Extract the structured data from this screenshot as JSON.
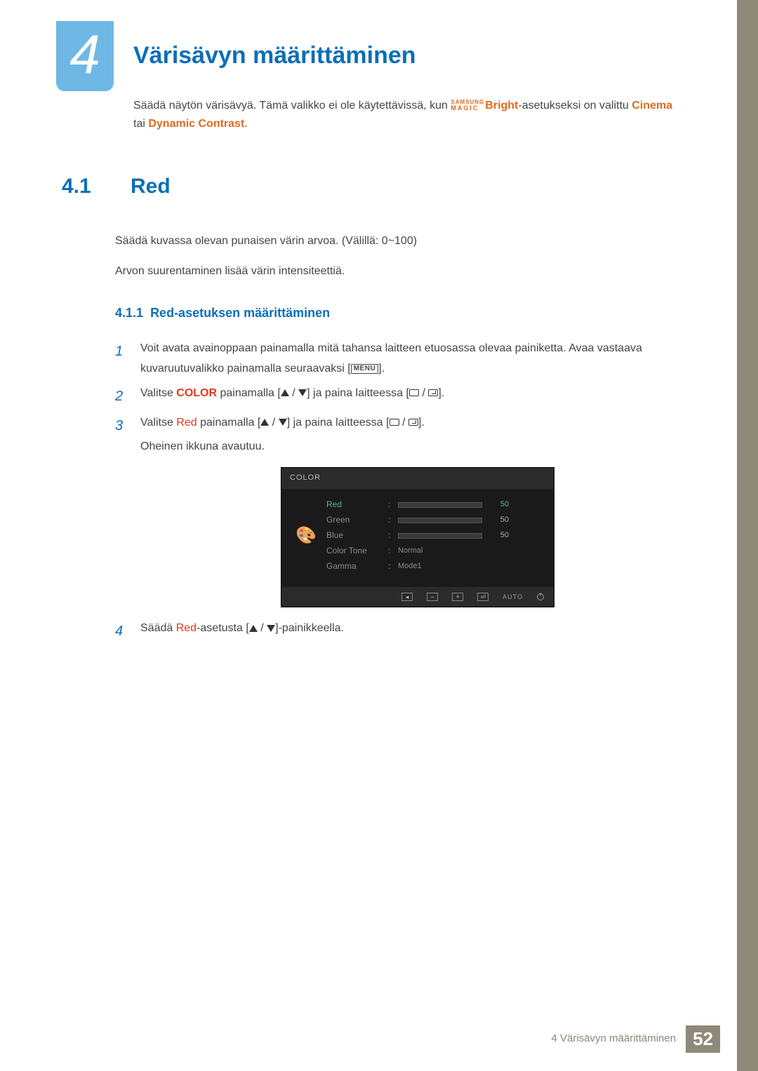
{
  "chapter": {
    "number": "4",
    "title": "Värisävyn määrittäminen"
  },
  "intro": {
    "part1": "Säädä näytön värisävyä. Tämä valikko ei ole käytettävissä, kun ",
    "magic_top": "SAMSUNG",
    "magic_bottom": "MAGIC",
    "bright": "Bright",
    "part2": "-asetukseksi on valittu ",
    "cinema": "Cinema",
    "or": " tai ",
    "dynamic": "Dynamic Contrast",
    "part3": "."
  },
  "section": {
    "num": "4.1",
    "title": "Red",
    "p1": "Säädä kuvassa olevan punaisen värin arvoa. (Välillä: 0~100)",
    "p2": "Arvon suurentaminen lisää värin intensiteettiä."
  },
  "subsection": {
    "num": "4.1.1",
    "title": "Red-asetuksen määrittäminen"
  },
  "steps": {
    "s1": {
      "n": "1",
      "a": "Voit avata avainoppaan painamalla mitä tahansa laitteen etuosassa olevaa painiketta. Avaa vastaava kuvaruutuvalikko painamalla seuraavaksi [",
      "menu": "MENU",
      "b": "]."
    },
    "s2": {
      "n": "2",
      "a": "Valitse ",
      "color": "COLOR",
      "b": " painamalla [",
      "c": "] ja paina laitteessa [",
      "d": "]."
    },
    "s3": {
      "n": "3",
      "a": "Valitse ",
      "red": "Red",
      "b": " painamalla [",
      "c": "] ja paina laitteessa [",
      "d": "].",
      "e": "Oheinen ikkuna avautuu."
    },
    "s4": {
      "n": "4",
      "a": "Säädä ",
      "red": "Red",
      "b": "-asetusta [",
      "c": "]-painikkeella."
    }
  },
  "osd": {
    "title": "COLOR",
    "rows": {
      "red": {
        "label": "Red",
        "value": "50"
      },
      "green": {
        "label": "Green",
        "value": "50"
      },
      "blue": {
        "label": "Blue",
        "value": "50"
      },
      "tone": {
        "label": "Color Tone",
        "value": "Normal"
      },
      "gamma": {
        "label": "Gamma",
        "value": "Mode1"
      }
    },
    "footer": {
      "auto": "AUTO"
    }
  },
  "footer": {
    "text": "4 Värisävyn määrittäminen",
    "page": "52"
  }
}
